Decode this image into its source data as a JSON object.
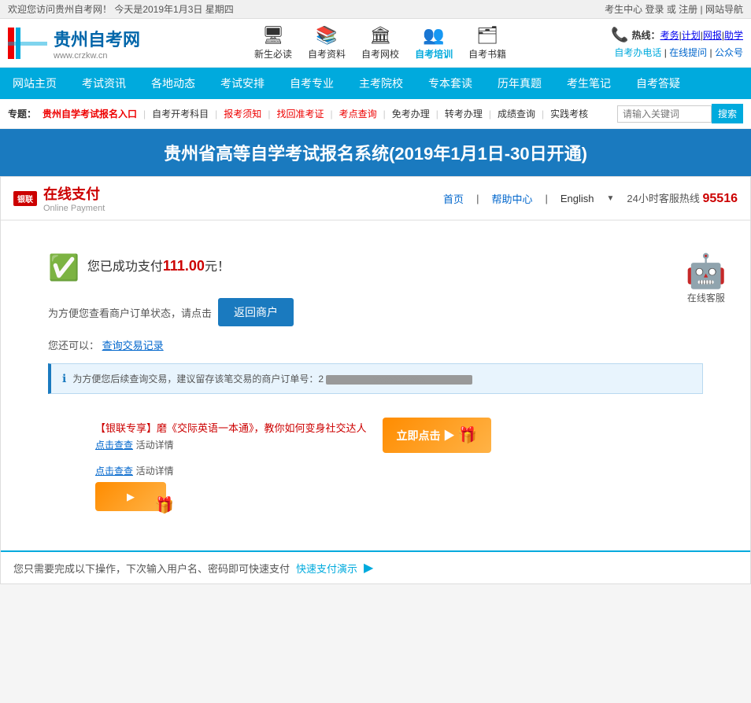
{
  "topbar": {
    "left": "欢迎您访问贵州自考网！  今天是2019年1月3日 星期四",
    "right_label": "考生中心",
    "login": "登录",
    "or": "或",
    "register": "注册",
    "site_guide": "网站导航"
  },
  "header": {
    "logo_main": "贵州自考网",
    "logo_sub": "www.crzkw.cn",
    "hotline_label": "热线：",
    "hotline_links": [
      "考务",
      "计划",
      "网报",
      "助学"
    ],
    "phone_label": "自考办电话",
    "online_label": "在线提问",
    "wechat_label": "公众号"
  },
  "nav_icons": [
    {
      "label": "新生必读",
      "icon": "🖥"
    },
    {
      "label": "自考资料",
      "icon": "📚"
    },
    {
      "label": "自考网校",
      "icon": "🏛"
    },
    {
      "label": "自考培训",
      "icon": "👥",
      "active": true
    },
    {
      "label": "自考书籍",
      "icon": "🗂"
    }
  ],
  "main_nav": {
    "items": [
      "网站主页",
      "考试资讯",
      "各地动态",
      "考试安排",
      "自考专业",
      "主考院校",
      "专本套读",
      "历年真题",
      "考生笔记",
      "自考答疑"
    ]
  },
  "sub_nav": {
    "label": "专题：",
    "links": [
      {
        "text": "贵州自学考试报名入口",
        "type": "highlight"
      },
      {
        "text": "自考开考科目",
        "type": "normal"
      },
      {
        "text": "报考须知",
        "type": "red"
      },
      {
        "text": "找回准考证",
        "type": "red"
      },
      {
        "text": "考点查询",
        "type": "red"
      },
      {
        "text": "免考办理",
        "type": "normal"
      },
      {
        "text": "转考办理",
        "type": "normal"
      },
      {
        "text": "成绩查询",
        "type": "normal"
      },
      {
        "text": "实践考核",
        "type": "normal"
      }
    ],
    "search_placeholder": "请输入关键词",
    "search_btn": "搜索"
  },
  "banner": {
    "text": "贵州省高等自学考试报名系统(2019年1月1日-30日开通)"
  },
  "payment": {
    "unionpay_badge": "银联",
    "unionpay_main": "在线支付",
    "unionpay_sub": "Online Payment",
    "header_links": [
      "首页",
      "帮助中心"
    ],
    "language": "English",
    "hotline_label": "24小时客服热线",
    "hotline_num": "95516",
    "success_msg_pre": "您已成功支付",
    "amount": "111.00",
    "currency": "元！",
    "return_prompt": "为方便您查看商户订单状态，请点击",
    "return_btn": "返回商户",
    "query_prompt": "您还可以：",
    "query_link": "查询交易记录",
    "info_text": "为方便您后续查询交易，建议留存该笔交易的商户订单号：2",
    "order_num_hidden": "（已遮蔽）",
    "online_service_label": "在线客服",
    "promo1_text": "【银联专享】磨《交际英语一本通》，教你如何变身社交达人",
    "promo1_detail": "点击查查",
    "promo1_detail2": "活动详情",
    "promo1_btn": "立即点击 ▶",
    "promo2_detail": "点击查查",
    "promo2_detail2": "活动详情"
  },
  "footer": {
    "text": "您只需要完成以下操作，下次输入用户名、密码即可快速支付",
    "link": "快速支付演示",
    "play": "▶"
  }
}
